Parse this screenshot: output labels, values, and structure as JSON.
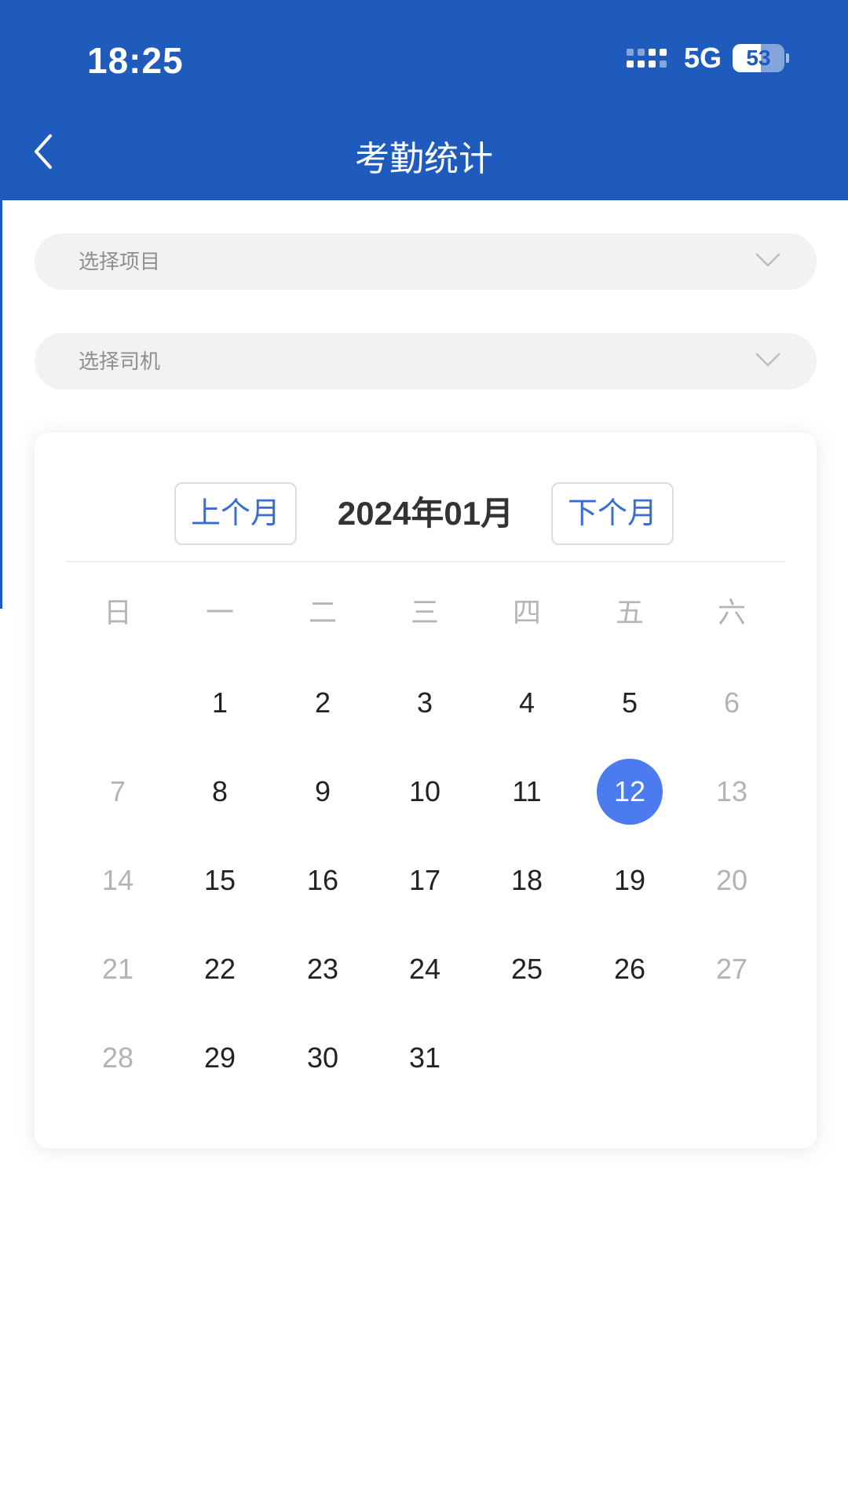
{
  "status_bar": {
    "time": "18:25",
    "network": "5G",
    "battery": "53"
  },
  "header": {
    "title": "考勤统计",
    "back_icon": "chevron-left-icon",
    "color": "#1f5bbd"
  },
  "filters": {
    "project_placeholder": "选择项目",
    "driver_placeholder": "选择司机",
    "dropdown_icon": "chevron-down-icon"
  },
  "calendar": {
    "prev_label": "上个月",
    "next_label": "下个月",
    "month_label": "2024年01月",
    "weekdays": [
      "日",
      "一",
      "二",
      "三",
      "四",
      "五",
      "六"
    ],
    "first_weekday": 1,
    "days_in_month": 31,
    "selected_day": 12,
    "selected_color": "#4b7bef"
  }
}
